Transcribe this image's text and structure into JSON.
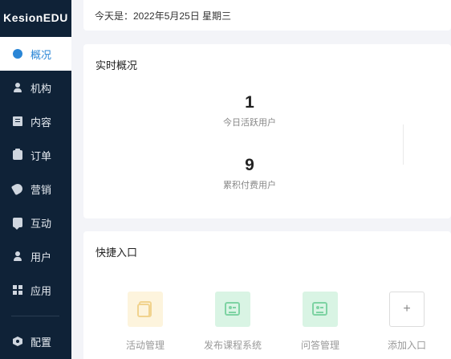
{
  "sidebar": {
    "brand": "KesionEDU",
    "items": [
      {
        "label": "概况",
        "icon": "dashboard-icon",
        "active": true
      },
      {
        "label": "机构",
        "icon": "person-icon"
      },
      {
        "label": "内容",
        "icon": "content-icon"
      },
      {
        "label": "订单",
        "icon": "clipboard-icon"
      },
      {
        "label": "营销",
        "icon": "tag-icon"
      },
      {
        "label": "互动",
        "icon": "chat-icon"
      },
      {
        "label": "用户",
        "icon": "user-icon"
      },
      {
        "label": "应用",
        "icon": "grid-icon"
      },
      {
        "label": "配置",
        "icon": "settings-icon"
      }
    ]
  },
  "header": {
    "date_text": "今天是：2022年5月25日 星期三"
  },
  "realtime": {
    "title": "实时概况",
    "stats": [
      {
        "value": "1",
        "label": "今日活跃用户"
      },
      {
        "value": "9",
        "label": "累积付费用户"
      }
    ]
  },
  "quick": {
    "title": "快捷入口",
    "items": [
      {
        "label": "活动管理",
        "icon": "activity-icon"
      },
      {
        "label": "发布课程系统",
        "icon": "course-icon"
      },
      {
        "label": "问答管理",
        "icon": "qa-icon"
      },
      {
        "label": "添加入口",
        "icon": "plus-icon",
        "glyph": "+"
      }
    ]
  },
  "colors": {
    "sidebar_bg": "#0f2237",
    "accent": "#2a86d6",
    "yellow_tile": "#fdf4dd",
    "green_tile": "#d9f4e4"
  }
}
